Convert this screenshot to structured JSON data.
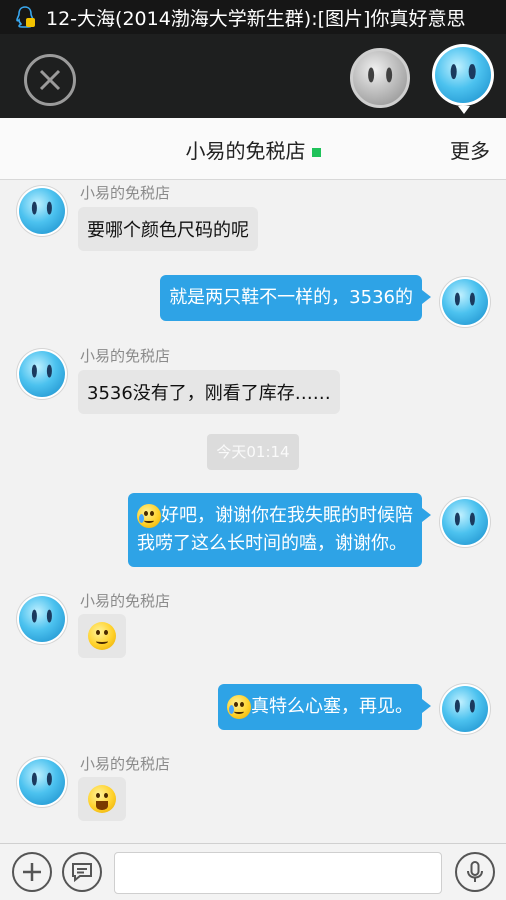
{
  "status_bar": {
    "notification": "12-大海(2014渤海大学新生群):[图片]你真好意思"
  },
  "header": {
    "title": "小易的免税店",
    "more_label": "更多",
    "online_color": "#1fc25a"
  },
  "messages": {
    "m1": {
      "sender": "小易的免税店",
      "text": "要哪个颜色尺码的呢"
    },
    "m2": {
      "text": "就是两只鞋不一样的，3536的"
    },
    "m3": {
      "sender": "小易的免税店",
      "text": "3536没有了，刚看了库存……"
    },
    "timestamp": "今天01:14",
    "m4": {
      "line1": "好吧，谢谢你在我失眠的时候陪",
      "line2": "我唠了这么长时间的嗑，谢谢你。",
      "emoji": "crying-face"
    },
    "m5": {
      "sender": "小易的免税店",
      "emoji": "smile-face"
    },
    "m6": {
      "text": "真特么心塞，再见。",
      "emoji": "crying-face"
    },
    "m7": {
      "sender": "小易的免税店",
      "emoji": "laugh-face"
    }
  },
  "input": {
    "placeholder": ""
  },
  "colors": {
    "outgoing_bubble": "#2ea3e6",
    "incoming_bubble": "#e6e6e6",
    "header_dark": "#1e1f1f"
  }
}
